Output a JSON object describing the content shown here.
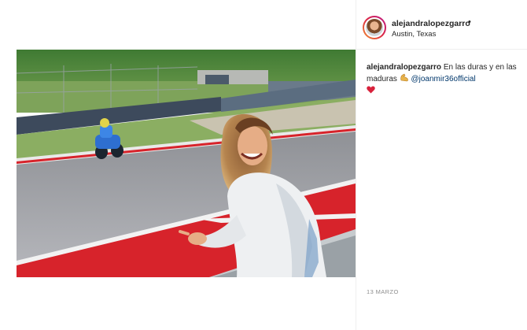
{
  "post": {
    "username": "alejandralopezgarro",
    "separator": "•",
    "location": "Austin, Texas",
    "caption_user": "alejandralopezgarro",
    "caption_text": "En las duras y en las maduras",
    "mention": "@joanmir36official",
    "date": "13 MARZO"
  },
  "icons": {
    "flexed_biceps": "flexed-biceps-emoji",
    "heart": "red-heart-emoji"
  },
  "colors": {
    "link": "#00376b",
    "muted": "#8e8e8e",
    "text": "#262626",
    "track_red": "#d7232b"
  }
}
